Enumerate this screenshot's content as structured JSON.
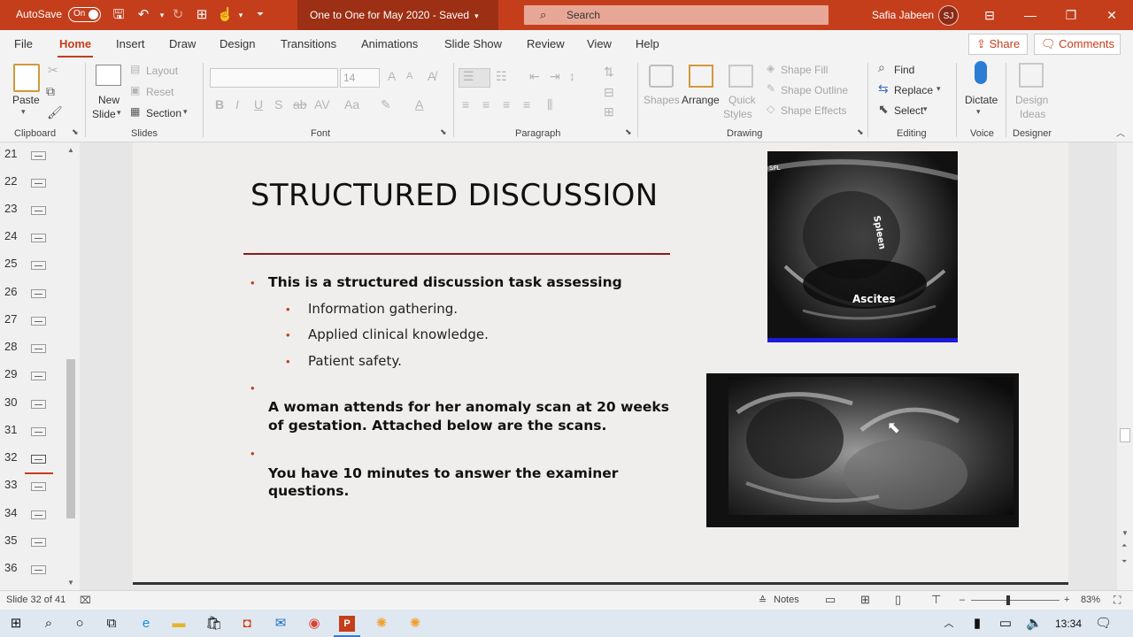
{
  "titlebar": {
    "autosave_label": "AutoSave",
    "autosave_state": "On",
    "doc_title": "One to One for May 2020  -  Saved",
    "search_placeholder": "Search",
    "user_name": "Safia Jabeen",
    "user_initials": "SJ",
    "accent_color": "#c43e1c"
  },
  "tabs": [
    "File",
    "Home",
    "Insert",
    "Draw",
    "Design",
    "Transitions",
    "Animations",
    "Slide Show",
    "Review",
    "View",
    "Help"
  ],
  "active_tab": "Home",
  "share_label": "Share",
  "comments_label": "Comments",
  "ribbon": {
    "clipboard": {
      "paste": "Paste",
      "label": "Clipboard"
    },
    "slides": {
      "new_slide": "New",
      "new_slide2": "Slide",
      "layout": "Layout",
      "reset": "Reset",
      "section": "Section",
      "label": "Slides"
    },
    "font": {
      "size": "14",
      "label": "Font"
    },
    "paragraph": {
      "label": "Paragraph"
    },
    "drawing": {
      "shapes": "Shapes",
      "arrange": "Arrange",
      "quick_styles": "Quick",
      "quick_styles2": "Styles",
      "shape_fill": "Shape Fill",
      "shape_outline": "Shape Outline",
      "shape_effects": "Shape Effects",
      "label": "Drawing"
    },
    "editing": {
      "find": "Find",
      "replace": "Replace",
      "select": "Select",
      "label": "Editing"
    },
    "voice": {
      "dictate": "Dictate",
      "label": "Voice"
    },
    "designer": {
      "design_ideas": "Design",
      "design_ideas2": "Ideas",
      "label": "Designer"
    }
  },
  "thumbnails": [
    "21",
    "22",
    "23",
    "24",
    "25",
    "26",
    "27",
    "28",
    "29",
    "30",
    "31",
    "32",
    "33",
    "34",
    "35",
    "36"
  ],
  "slide": {
    "title": "STRUCTURED DISCUSSION",
    "bullet1": "This is a structured discussion task assessing",
    "sub1": "Information gathering.",
    "sub2": "Applied clinical knowledge.",
    "sub3": "Patient safety.",
    "bullet2_line1": "A woman attends for her anomaly scan at 20 weeks",
    "bullet2_line2": "of gestation. Attached below are the scans.",
    "bullet3_line1": "You have 10 minutes to answer the examiner",
    "bullet3_line2": "questions.",
    "img1_corner": "SPL",
    "img1_label_spleen": "Spleen",
    "img1_label_ascites": "Ascites"
  },
  "status": {
    "slide_info": "Slide 32 of 41",
    "notes": "Notes",
    "zoom": "83%",
    "zoom_minus": "–",
    "zoom_plus": "+"
  },
  "taskbar": {
    "time": "13:34"
  }
}
